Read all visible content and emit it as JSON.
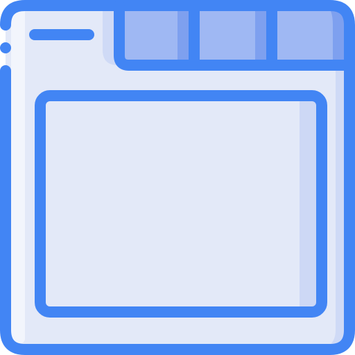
{
  "icon": {
    "name": "browser-window-icon",
    "colors": {
      "stroke": "#4285F4",
      "frame_fill": "#E3E9F8",
      "frame_shade": "#CFDAF6",
      "tab_fill": "#9FB8F3",
      "tab_shade": "#7EA0EF",
      "content_fill": "#E3E9F8",
      "content_shade": "#CDD8F5",
      "background": "#FFFFFF"
    },
    "tab_count": 3
  }
}
